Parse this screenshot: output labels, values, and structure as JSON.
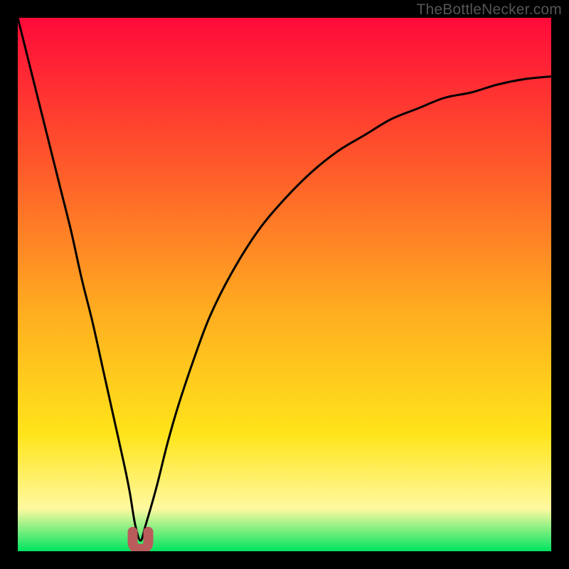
{
  "attribution": "TheBottleNecker.com",
  "colors": {
    "frame": "#000000",
    "gradient_top": "#ff0a3a",
    "gradient_mid1": "#ff5a2a",
    "gradient_mid2": "#ffad20",
    "gradient_mid3": "#ffe41a",
    "gradient_pale": "#fff9a0",
    "gradient_bottom": "#00e460",
    "curve": "#000000",
    "marker": "#bb5c5c"
  },
  "chart_data": {
    "type": "line",
    "title": "",
    "xlabel": "",
    "ylabel": "",
    "xlim": [
      0,
      100
    ],
    "ylim": [
      0,
      100
    ],
    "series": [
      {
        "name": "bottleneck-curve",
        "x": [
          0,
          2,
          4,
          6,
          8,
          10,
          12,
          14,
          16,
          18,
          20,
          21,
          22,
          23,
          24,
          26,
          28,
          30,
          33,
          36,
          40,
          45,
          50,
          55,
          60,
          65,
          70,
          75,
          80,
          85,
          90,
          95,
          100
        ],
        "y": [
          100,
          92,
          84,
          76,
          68,
          60,
          51,
          43,
          34,
          25,
          16,
          11,
          5,
          2,
          5,
          12,
          20,
          27,
          36,
          44,
          52,
          60,
          66,
          71,
          75,
          78,
          81,
          83,
          85,
          86,
          87.5,
          88.5,
          89
        ]
      }
    ],
    "annotations": [
      {
        "name": "optimal-minimum",
        "x": 23,
        "y": 1.5
      }
    ]
  }
}
